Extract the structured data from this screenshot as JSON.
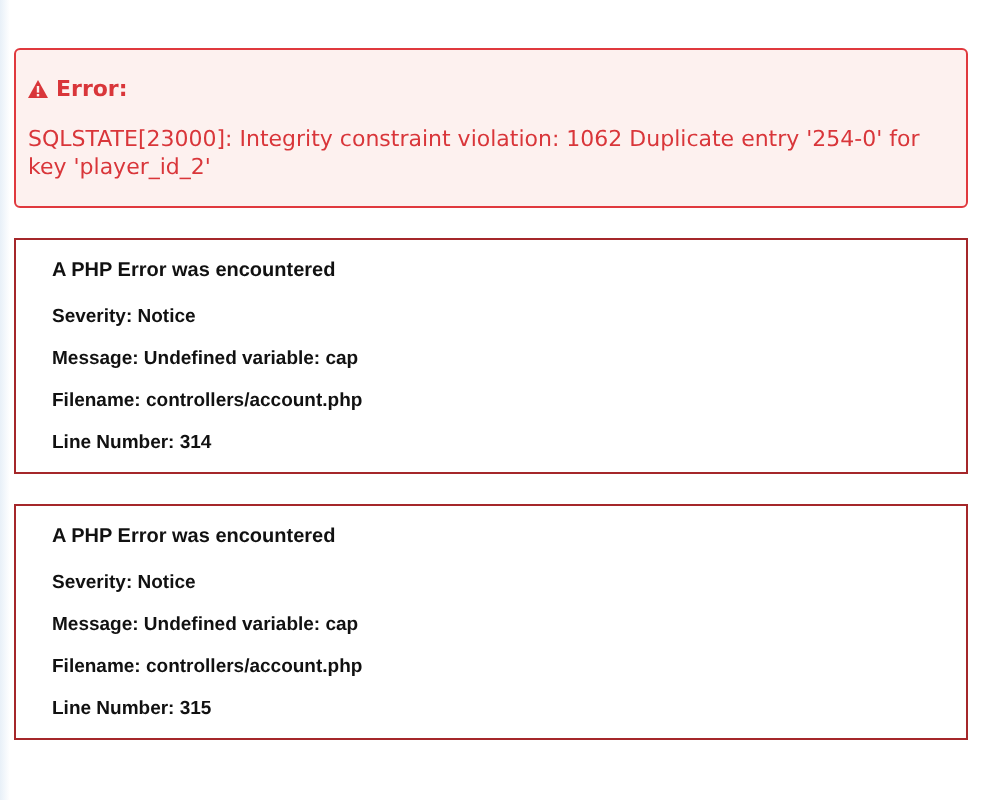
{
  "alert": {
    "title": "Error:",
    "message": "SQLSTATE[23000]: Integrity constraint violation: 1062 Duplicate entry '254-0' for key 'player_id_2'"
  },
  "php_errors": [
    {
      "heading": "A PHP Error was encountered",
      "lines": [
        "Severity: Notice",
        "Message: Undefined variable: cap",
        "Filename: controllers/account.php",
        "Line Number: 314"
      ]
    },
    {
      "heading": "A PHP Error was encountered",
      "lines": [
        "Severity: Notice",
        "Message: Undefined variable: cap",
        "Filename: controllers/account.php",
        "Line Number: 315"
      ]
    }
  ]
}
